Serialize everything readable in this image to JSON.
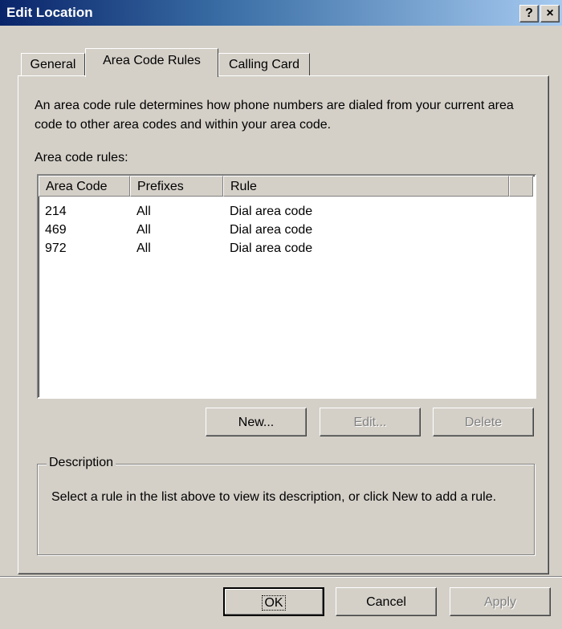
{
  "window": {
    "title": "Edit Location"
  },
  "titlebar_buttons": {
    "help": "?",
    "close": "×"
  },
  "tabs": [
    {
      "label": "General"
    },
    {
      "label": "Area Code Rules"
    },
    {
      "label": "Calling Card"
    }
  ],
  "intro_text": "An area code rule determines how phone numbers are dialed from your current area code to other area codes and within your area code.",
  "rules_label": "Area code rules:",
  "list": {
    "columns": [
      "Area Code",
      "Prefixes",
      "Rule"
    ],
    "rows": [
      {
        "area_code": "214",
        "prefixes": "All",
        "rule": "Dial area code"
      },
      {
        "area_code": "469",
        "prefixes": "All",
        "rule": "Dial area code"
      },
      {
        "area_code": "972",
        "prefixes": "All",
        "rule": "Dial area code"
      }
    ]
  },
  "rule_buttons": {
    "new": "New...",
    "edit": "Edit...",
    "delete": "Delete"
  },
  "description": {
    "title": "Description",
    "text": "Select a rule in the list above to view its description, or click New to add a rule."
  },
  "dialog_buttons": {
    "ok": "OK",
    "cancel": "Cancel",
    "apply": "Apply"
  }
}
